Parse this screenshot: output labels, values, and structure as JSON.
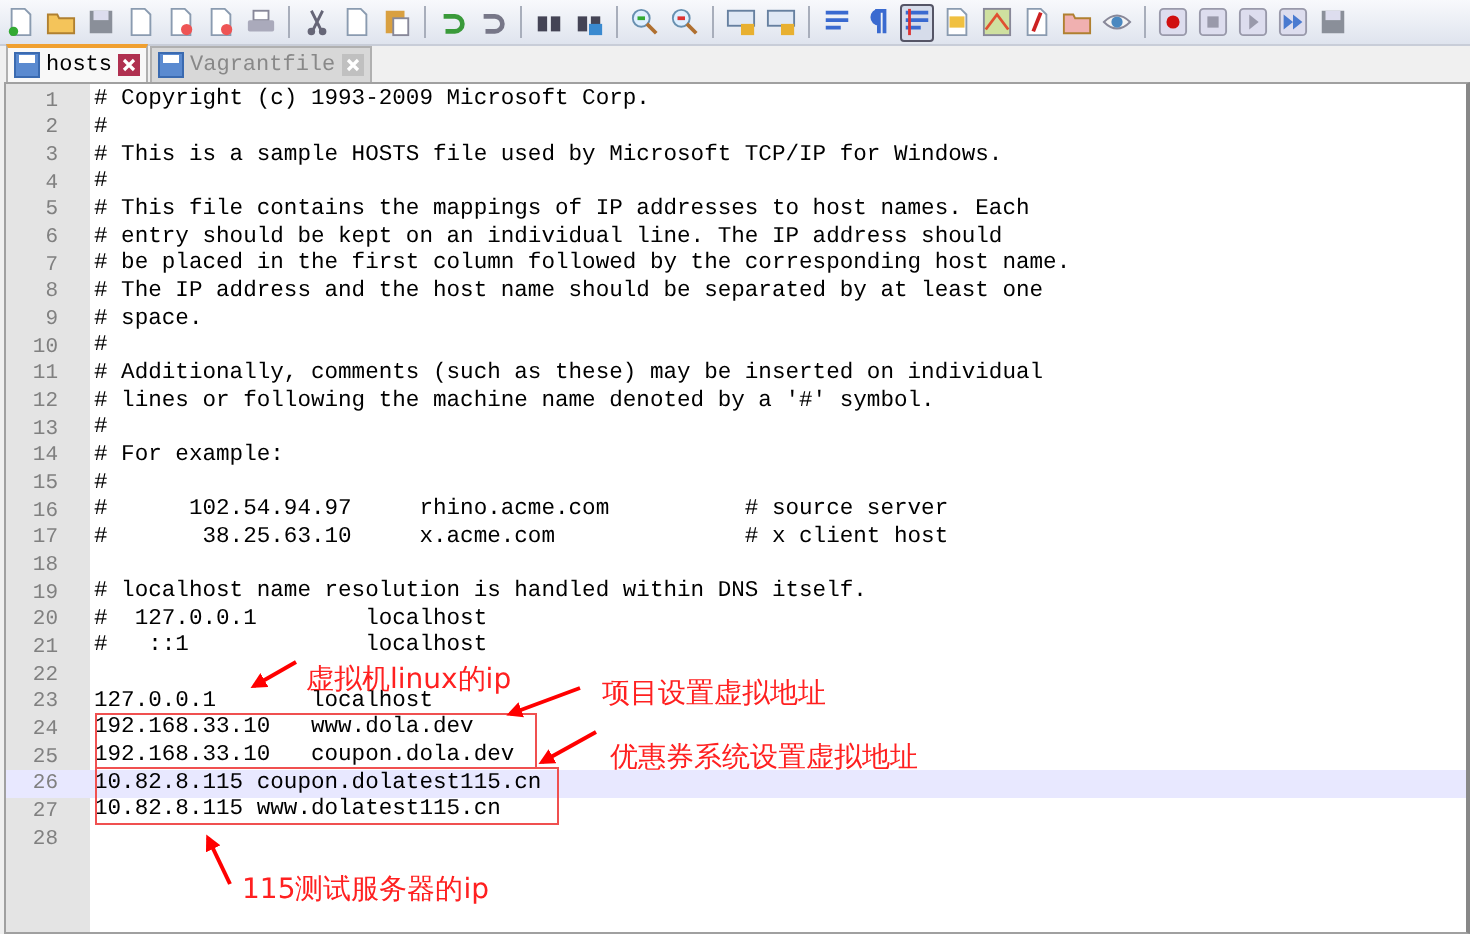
{
  "toolbar": [
    {
      "pressed": false
    },
    {
      "pressed": false
    },
    {
      "pressed": false
    },
    {
      "pressed": false
    },
    {
      "pressed": false
    },
    {
      "pressed": false
    },
    {
      "pressed": false
    },
    {
      "pressed": false
    },
    {
      "pressed": false
    },
    {
      "pressed": false
    },
    {
      "pressed": false
    },
    {
      "pressed": false
    },
    {
      "pressed": false
    },
    {
      "pressed": false
    },
    {
      "pressed": false
    },
    {
      "pressed": false
    },
    {
      "pressed": false
    },
    {
      "pressed": false
    },
    {
      "pressed": false
    },
    {
      "pressed": false
    },
    {
      "pressed": true
    },
    {
      "pressed": false
    },
    {
      "pressed": false
    },
    {
      "pressed": false
    },
    {
      "pressed": false
    },
    {
      "pressed": false
    },
    {
      "pressed": false
    },
    {
      "pressed": false
    },
    {
      "pressed": false
    },
    {
      "pressed": false
    },
    {
      "pressed": false
    }
  ],
  "tabs": [
    {
      "label": "hosts",
      "selected": true
    },
    {
      "label": "Vagrantfile",
      "selected": false
    }
  ],
  "lines": [
    {
      "number": "1",
      "text": "# Copyright (c) 1993-2009 Microsoft Corp.",
      "current": false
    },
    {
      "number": "2",
      "text": "#",
      "current": false
    },
    {
      "number": "3",
      "text": "# This is a sample HOSTS file used by Microsoft TCP/IP for Windows.",
      "current": false
    },
    {
      "number": "4",
      "text": "#",
      "current": false
    },
    {
      "number": "5",
      "text": "# This file contains the mappings of IP addresses to host names. Each",
      "current": false
    },
    {
      "number": "6",
      "text": "# entry should be kept on an individual line. The IP address should",
      "current": false
    },
    {
      "number": "7",
      "text": "# be placed in the first column followed by the corresponding host name.",
      "current": false
    },
    {
      "number": "8",
      "text": "# The IP address and the host name should be separated by at least one",
      "current": false
    },
    {
      "number": "9",
      "text": "# space.",
      "current": false
    },
    {
      "number": "10",
      "text": "#",
      "current": false
    },
    {
      "number": "11",
      "text": "# Additionally, comments (such as these) may be inserted on individual",
      "current": false
    },
    {
      "number": "12",
      "text": "# lines or following the machine name denoted by a '#' symbol.",
      "current": false
    },
    {
      "number": "13",
      "text": "#",
      "current": false
    },
    {
      "number": "14",
      "text": "# For example:",
      "current": false
    },
    {
      "number": "15",
      "text": "#",
      "current": false
    },
    {
      "number": "16",
      "text": "#      102.54.94.97     rhino.acme.com          # source server",
      "current": false
    },
    {
      "number": "17",
      "text": "#       38.25.63.10     x.acme.com              # x client host",
      "current": false
    },
    {
      "number": "18",
      "current": false
    },
    {
      "number": "19",
      "text": "# localhost name resolution is handled within DNS itself.",
      "current": false
    },
    {
      "number": "20",
      "text": "#  127.0.0.1        localhost",
      "current": false
    },
    {
      "number": "21",
      "text": "#   ::1             localhost",
      "current": false
    },
    {
      "number": "22",
      "current": false
    },
    {
      "number": "23",
      "text": "127.0.0.1       localhost",
      "current": false
    },
    {
      "number": "24",
      "text": "192.168.33.10   www.dola.dev",
      "current": false
    },
    {
      "number": "25",
      "text": "192.168.33.10   coupon.dola.dev",
      "current": false
    },
    {
      "number": "26",
      "text": "10.82.8.115 coupon.dolatest115.cn",
      "current": true
    },
    {
      "number": "27",
      "text": "10.82.8.115 www.dolatest115.cn",
      "current": false
    },
    {
      "number": "28",
      "current": false
    }
  ],
  "annotations": [
    {
      "label": "虚拟机linux的ip"
    },
    {
      "label": "项目设置虚拟地址"
    },
    {
      "label": "优惠券系统设置虚拟地址"
    },
    {
      "label": "115测试服务器的ip"
    }
  ]
}
